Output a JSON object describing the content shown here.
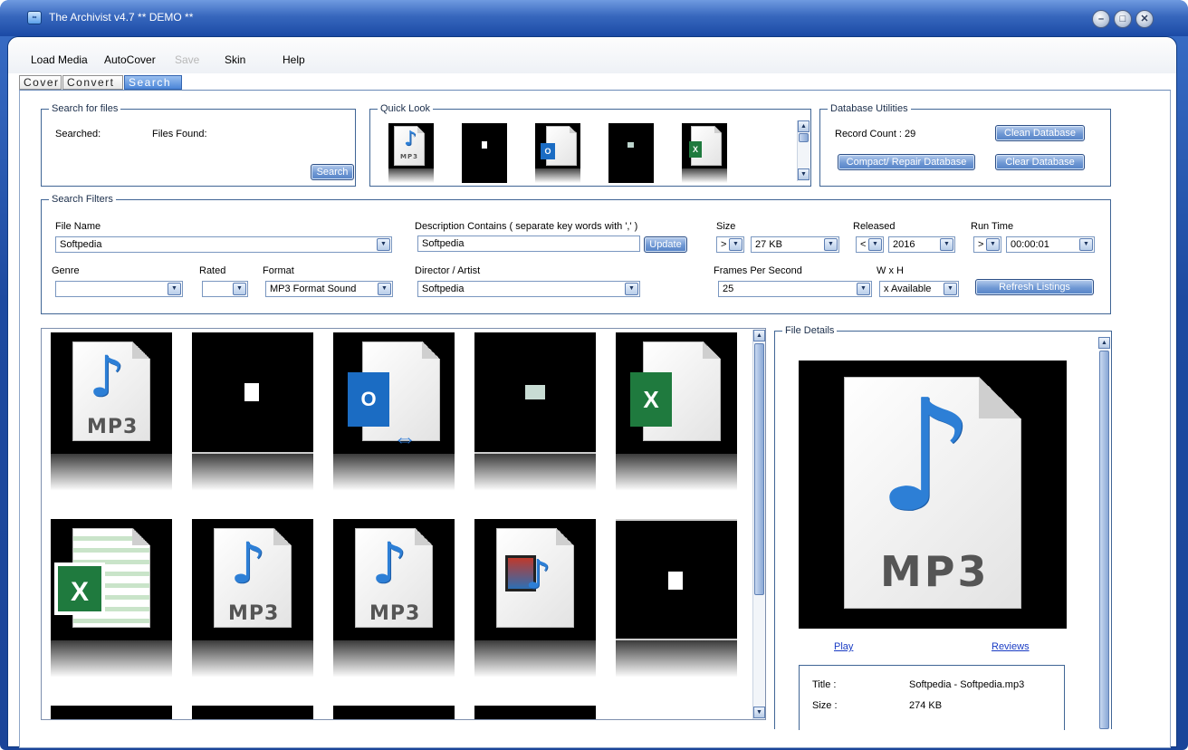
{
  "window": {
    "title": "The Archivist  v4.7 ** DEMO **",
    "app_icon": "archivist-logo-icon"
  },
  "menu": {
    "items": [
      "Load Media",
      "AutoCover",
      "Save",
      "Skin",
      "Help"
    ],
    "disabled": [
      "Save"
    ]
  },
  "tabs": [
    {
      "label": "Cover"
    },
    {
      "label": "Convert"
    },
    {
      "label": "Search",
      "active": true
    }
  ],
  "search_files": {
    "legend": "Search for files",
    "searched_label": "Searched:",
    "found_label": "Files Found:",
    "search_button": "Search"
  },
  "quick_look": {
    "legend": "Quick Look",
    "items": [
      "mp3-file-icon",
      "blank-file-icon",
      "outlook-file-icon",
      "image-file-icon",
      "excel-file-icon"
    ],
    "mp3_text": "MP3"
  },
  "db_utils": {
    "legend": "Database Utilities",
    "record_count": "Record Count :  29",
    "clean_button": "Clean Database",
    "compact_button": "Compact/ Repair Database",
    "clear_button": "Clear Database"
  },
  "filters": {
    "legend": "Search Filters",
    "file_name": {
      "label": "File Name",
      "value": "Softpedia"
    },
    "description": {
      "label": "Description Contains  ( separate key words with ',' )",
      "value": "Softpedia",
      "update_button": "Update"
    },
    "size": {
      "label": "Size",
      "op": ">",
      "value": "27 KB"
    },
    "released": {
      "label": "Released",
      "op": "<",
      "value": "2016"
    },
    "run_time": {
      "label": "Run Time",
      "op": ">",
      "value": "00:00:01"
    },
    "genre": {
      "label": "Genre",
      "value": ""
    },
    "rated": {
      "label": "Rated",
      "value": ""
    },
    "format": {
      "label": "Format",
      "value": "MP3 Format Sound"
    },
    "director": {
      "label": "Director / Artist",
      "value": "Softpedia"
    },
    "fps": {
      "label": "Frames Per Second",
      "value": "25"
    },
    "wxh": {
      "label": "W x H",
      "value": "x Available"
    },
    "refresh_button": "Refresh Listings"
  },
  "results": {
    "items": [
      "mp3-file-icon",
      "blank-file-icon",
      "outlook-file-icon",
      "image-file-icon",
      "excel-file-icon",
      "excel-sheet-icon",
      "mp3-file-icon",
      "mp3-file-icon",
      "video-audio-file-icon",
      "blank-file-icon"
    ],
    "mp3_text": "MP3",
    "xl_text": "X",
    "ol_text": "O"
  },
  "file_details": {
    "legend": "File Details",
    "play_link": "Play",
    "reviews_link": "Reviews",
    "title_label": "Title :",
    "title_value": "Softpedia - Softpedia.mp3",
    "size_label": "Size :",
    "size_value": "274 KB",
    "mp3_text": "MP3"
  },
  "icons": {
    "minimize": "minimize-icon",
    "maximize": "maximize-icon",
    "close": "close-icon",
    "dropdown": "chevron-down-icon",
    "scroll_up": "scroll-up-icon",
    "scroll_down": "scroll-down-icon"
  },
  "glyphs": {
    "minimize": "–",
    "maximize": "□",
    "close": "✕",
    "down": "▼",
    "up": "▲",
    "ctrl": "∞"
  },
  "colors": {
    "title_bar": "#2a5bb5",
    "button_blue": "#6f98d4",
    "link": "#1a3cc4",
    "thumb_bg": "#000000"
  }
}
